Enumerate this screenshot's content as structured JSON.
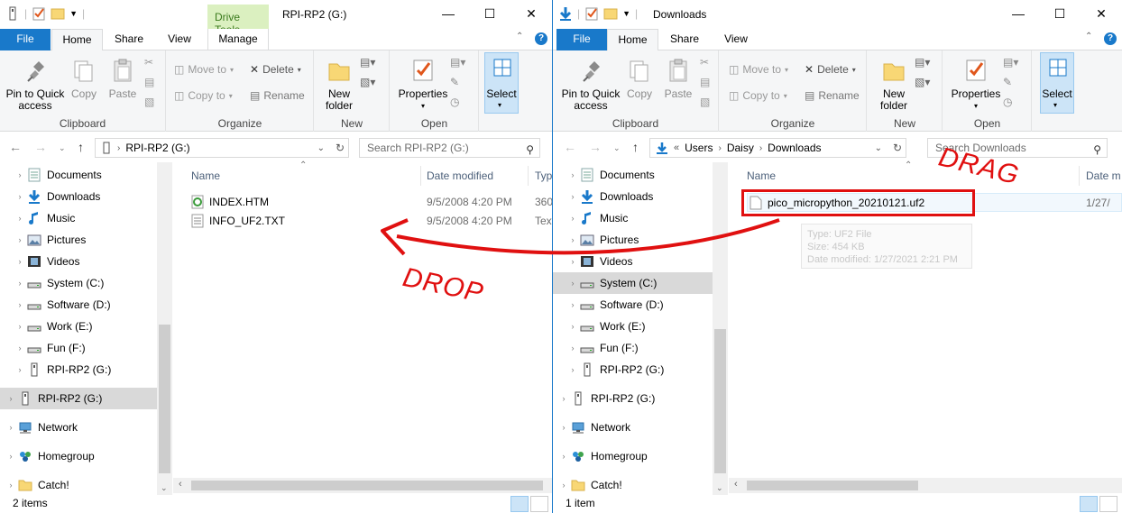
{
  "left_window": {
    "title": "RPI-RP2 (G:)",
    "context_tab": "Drive Tools",
    "tabs": [
      "File",
      "Home",
      "Share",
      "View",
      "Manage"
    ],
    "active_tab": "Home",
    "ribbon": {
      "clipboard": {
        "pin": "Pin to Quick access",
        "copy": "Copy",
        "paste": "Paste",
        "label": "Clipboard"
      },
      "organize": {
        "move_to": "Move to",
        "copy_to": "Copy to",
        "delete": "Delete",
        "rename": "Rename",
        "label": "Organize"
      },
      "new": {
        "new_folder": "New folder",
        "label": "New"
      },
      "open": {
        "properties": "Properties",
        "label": "Open"
      },
      "select": {
        "select": "Select"
      }
    },
    "address": {
      "path": [
        "RPI-RP2 (G:)"
      ],
      "search_placeholder": "Search RPI-RP2 (G:)"
    },
    "nav_items": [
      {
        "label": "Documents",
        "icon": "documents-icon"
      },
      {
        "label": "Downloads",
        "icon": "downloads-icon"
      },
      {
        "label": "Music",
        "icon": "music-icon"
      },
      {
        "label": "Pictures",
        "icon": "pictures-icon"
      },
      {
        "label": "Videos",
        "icon": "videos-icon"
      },
      {
        "label": "System (C:)",
        "icon": "drive-icon"
      },
      {
        "label": "Software (D:)",
        "icon": "drive-icon"
      },
      {
        "label": "Work (E:)",
        "icon": "drive-icon"
      },
      {
        "label": "Fun (F:)",
        "icon": "drive-icon"
      },
      {
        "label": "RPI-RP2 (G:)",
        "icon": "usb-drive-icon"
      }
    ],
    "nav_roots": [
      {
        "label": "RPI-RP2 (G:)",
        "icon": "usb-drive-icon",
        "selected": true
      },
      {
        "label": "Network",
        "icon": "network-icon"
      },
      {
        "label": "Homegroup",
        "icon": "homegroup-icon"
      },
      {
        "label": "Catch!",
        "icon": "folder-icon"
      }
    ],
    "columns": [
      "Name",
      "Date modified",
      "Typ"
    ],
    "files": [
      {
        "name": "INDEX.HTM",
        "date": "9/5/2008 4:20 PM",
        "type": "360",
        "icon": "html-file-icon"
      },
      {
        "name": "INFO_UF2.TXT",
        "date": "9/5/2008 4:20 PM",
        "type": "Text",
        "icon": "text-file-icon"
      }
    ],
    "status": "2 items"
  },
  "right_window": {
    "title": "Downloads",
    "tabs": [
      "File",
      "Home",
      "Share",
      "View"
    ],
    "active_tab": "Home",
    "ribbon": {
      "clipboard": {
        "pin": "Pin to Quick access",
        "copy": "Copy",
        "paste": "Paste",
        "label": "Clipboard"
      },
      "organize": {
        "move_to": "Move to",
        "copy_to": "Copy to",
        "delete": "Delete",
        "rename": "Rename",
        "label": "Organize"
      },
      "new": {
        "new_folder": "New folder",
        "label": "New"
      },
      "open": {
        "properties": "Properties",
        "label": "Open"
      },
      "select": {
        "select": "Select"
      }
    },
    "address": {
      "path": [
        "Users",
        "Daisy",
        "Downloads"
      ],
      "search_placeholder": "Search Downloads"
    },
    "nav_items": [
      {
        "label": "Documents",
        "icon": "documents-icon"
      },
      {
        "label": "Downloads",
        "icon": "downloads-icon"
      },
      {
        "label": "Music",
        "icon": "music-icon"
      },
      {
        "label": "Pictures",
        "icon": "pictures-icon"
      },
      {
        "label": "Videos",
        "icon": "videos-icon"
      },
      {
        "label": "System (C:)",
        "icon": "drive-icon",
        "selected": true
      },
      {
        "label": "Software (D:)",
        "icon": "drive-icon"
      },
      {
        "label": "Work (E:)",
        "icon": "drive-icon"
      },
      {
        "label": "Fun (F:)",
        "icon": "drive-icon"
      },
      {
        "label": "RPI-RP2 (G:)",
        "icon": "usb-drive-icon"
      }
    ],
    "nav_roots": [
      {
        "label": "RPI-RP2 (G:)",
        "icon": "usb-drive-icon"
      },
      {
        "label": "Network",
        "icon": "network-icon"
      },
      {
        "label": "Homegroup",
        "icon": "homegroup-icon"
      },
      {
        "label": "Catch!",
        "icon": "folder-icon"
      }
    ],
    "columns": [
      "Name",
      "Date m"
    ],
    "files": [
      {
        "name": "pico_micropython_20210121.uf2",
        "date": "1/27/",
        "icon": "file-icon"
      }
    ],
    "tooltip": {
      "type": "Type: UF2 File",
      "size": "Size: 454 KB",
      "date": "Date modified: 1/27/2021 2:21 PM"
    },
    "status": "1 item"
  },
  "annotations": {
    "drag": "DRAG",
    "drop": "DROP",
    "color": "#e01010"
  },
  "colors": {
    "accent": "#1979ca",
    "context_tab_bg": "#dbf0c0",
    "selected_bg": "#cce4f7"
  }
}
